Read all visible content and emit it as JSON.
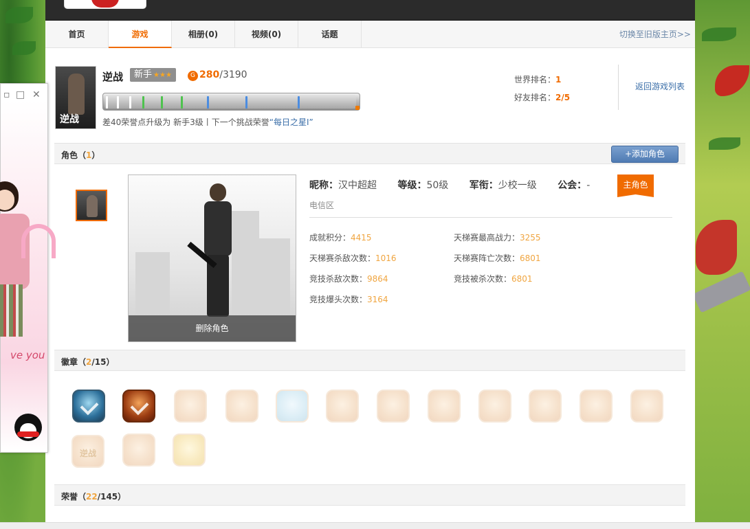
{
  "nav": {
    "tabs": [
      {
        "label": "首页"
      },
      {
        "label": "游戏"
      },
      {
        "label": "相册(0)"
      },
      {
        "label": "视频(0)"
      },
      {
        "label": "话题"
      }
    ],
    "active_tab": "游戏",
    "switch_link": "切换至旧版主页>>"
  },
  "game": {
    "thumb_logo": "逆战",
    "title": "逆战",
    "rank_label": "新手",
    "rank_stars": "★★★",
    "coin_icon": "honor-coin-icon",
    "points_current": "280",
    "points_total": "/3190",
    "progress_fraction": 0.993,
    "hint_text": "差40荣誉点升级为 新手3级丨下一个挑战荣誉",
    "hint_link": "“每日之星Ⅰ”",
    "world_rank_label": "世界排名：",
    "world_rank_value": "1",
    "friend_rank_label": "好友排名：",
    "friend_rank_value": "2/5",
    "back_link": "返回游戏列表"
  },
  "roles": {
    "title": "角色（",
    "count": "1",
    "close": "）",
    "add_button": "+添加角色",
    "delete_button": "删除角色",
    "nickname_label": "昵称：",
    "nickname": "汉中超超",
    "level_label": "等级：",
    "level": "50级",
    "rank_label": "军衔：",
    "rank": "少校一级",
    "guild_label": "公会：",
    "guild": "-",
    "main_role_badge": "主角色",
    "server": "电信区",
    "stats": [
      {
        "label": "成就积分：",
        "value": "4415"
      },
      {
        "label": "天梯赛最高战力：",
        "value": "3255"
      },
      {
        "label": "天梯赛杀敌次数：",
        "value": "1016"
      },
      {
        "label": "天梯赛阵亡次数：",
        "value": "6801"
      },
      {
        "label": "竞技杀敌次数：",
        "value": "9864"
      },
      {
        "label": "竞技被杀次数：",
        "value": "6801"
      },
      {
        "label": "竞技爆头次数：",
        "value": "3164"
      }
    ]
  },
  "badges": {
    "title": "徽章（",
    "earned": "2",
    "total": "/15",
    "close": "）",
    "thumb_logo": "逆战"
  },
  "honors": {
    "title": "荣誉（",
    "earned": "22",
    "total": "/145",
    "close": "）"
  },
  "popup": {
    "minimize": "▫",
    "close": "✕",
    "art_text": "ve you"
  }
}
